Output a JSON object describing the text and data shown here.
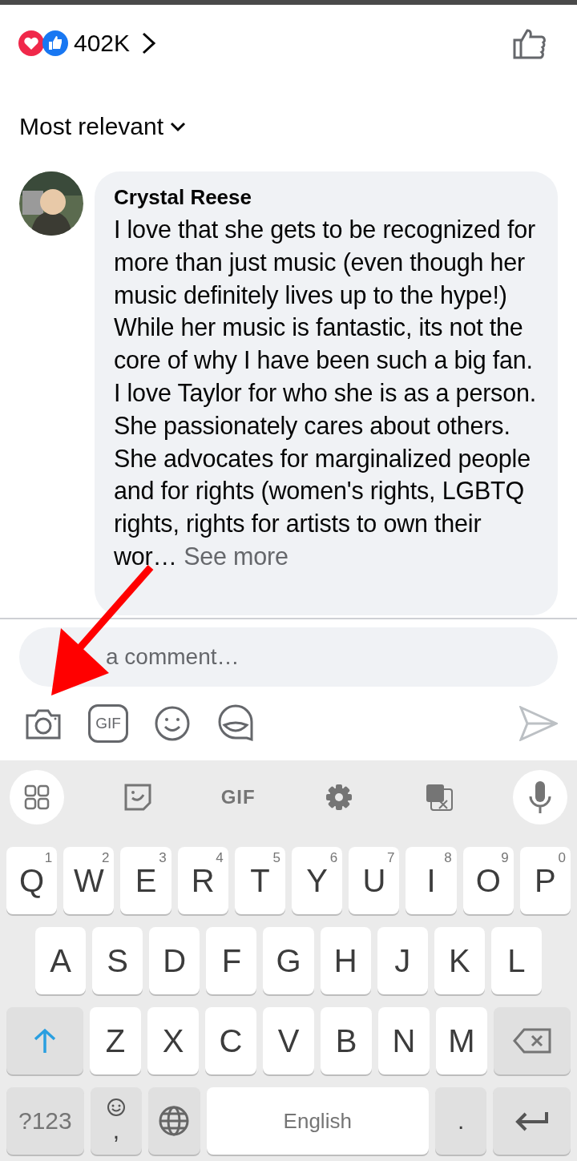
{
  "reactions": {
    "count": "402K"
  },
  "sort": {
    "label": "Most relevant"
  },
  "comment": {
    "author": "Crystal Reese",
    "text": "I love that she gets to be recognized for more than just music (even though her music definitely lives up to the hype!) While her music is fantastic, its not the core of why I have been such a big fan. I love Taylor for who she is as a person. She passionately cares about others. She advocates for marginalized people and for rights (women's rights, LGBTQ rights, rights for artists to own their wor…",
    "more": "See more"
  },
  "composer": {
    "placeholder": "a comment…",
    "tools": [
      {
        "kind": "camera"
      },
      {
        "kind": "gif",
        "label": "GIF"
      },
      {
        "kind": "emoji"
      },
      {
        "kind": "sticker"
      }
    ]
  },
  "keyboard": {
    "toolbar": [
      {
        "kind": "apps"
      },
      {
        "kind": "sticker"
      },
      {
        "kind": "gif",
        "label": "GIF"
      },
      {
        "kind": "settings"
      },
      {
        "kind": "translate"
      },
      {
        "kind": "mic"
      }
    ],
    "rows": [
      {
        "keys": [
          {
            "kind": "letter",
            "label": "Q",
            "hint": "1"
          },
          {
            "kind": "letter",
            "label": "W",
            "hint": "2"
          },
          {
            "kind": "letter",
            "label": "E",
            "hint": "3"
          },
          {
            "kind": "letter",
            "label": "R",
            "hint": "4"
          },
          {
            "kind": "letter",
            "label": "T",
            "hint": "5"
          },
          {
            "kind": "letter",
            "label": "Y",
            "hint": "6"
          },
          {
            "kind": "letter",
            "label": "U",
            "hint": "7"
          },
          {
            "kind": "letter",
            "label": "I",
            "hint": "8"
          },
          {
            "kind": "letter",
            "label": "O",
            "hint": "9"
          },
          {
            "kind": "letter",
            "label": "P",
            "hint": "0"
          }
        ]
      },
      {
        "keys": [
          {
            "kind": "letter",
            "label": "A"
          },
          {
            "kind": "letter",
            "label": "S"
          },
          {
            "kind": "letter",
            "label": "D"
          },
          {
            "kind": "letter",
            "label": "F"
          },
          {
            "kind": "letter",
            "label": "G"
          },
          {
            "kind": "letter",
            "label": "H"
          },
          {
            "kind": "letter",
            "label": "J"
          },
          {
            "kind": "letter",
            "label": "K"
          },
          {
            "kind": "letter",
            "label": "L"
          }
        ]
      },
      {
        "keys": [
          {
            "kind": "shift",
            "on": true
          },
          {
            "kind": "letter",
            "label": "Z"
          },
          {
            "kind": "letter",
            "label": "X"
          },
          {
            "kind": "letter",
            "label": "C"
          },
          {
            "kind": "letter",
            "label": "V"
          },
          {
            "kind": "letter",
            "label": "B"
          },
          {
            "kind": "letter",
            "label": "N"
          },
          {
            "kind": "letter",
            "label": "M"
          },
          {
            "kind": "backspace"
          }
        ]
      },
      {
        "keys": [
          {
            "kind": "symbols",
            "label": "?123"
          },
          {
            "kind": "emoji-comma",
            "label": ","
          },
          {
            "kind": "globe"
          },
          {
            "kind": "space",
            "label": "English"
          },
          {
            "kind": "period",
            "label": "."
          },
          {
            "kind": "enter"
          }
        ]
      }
    ]
  }
}
